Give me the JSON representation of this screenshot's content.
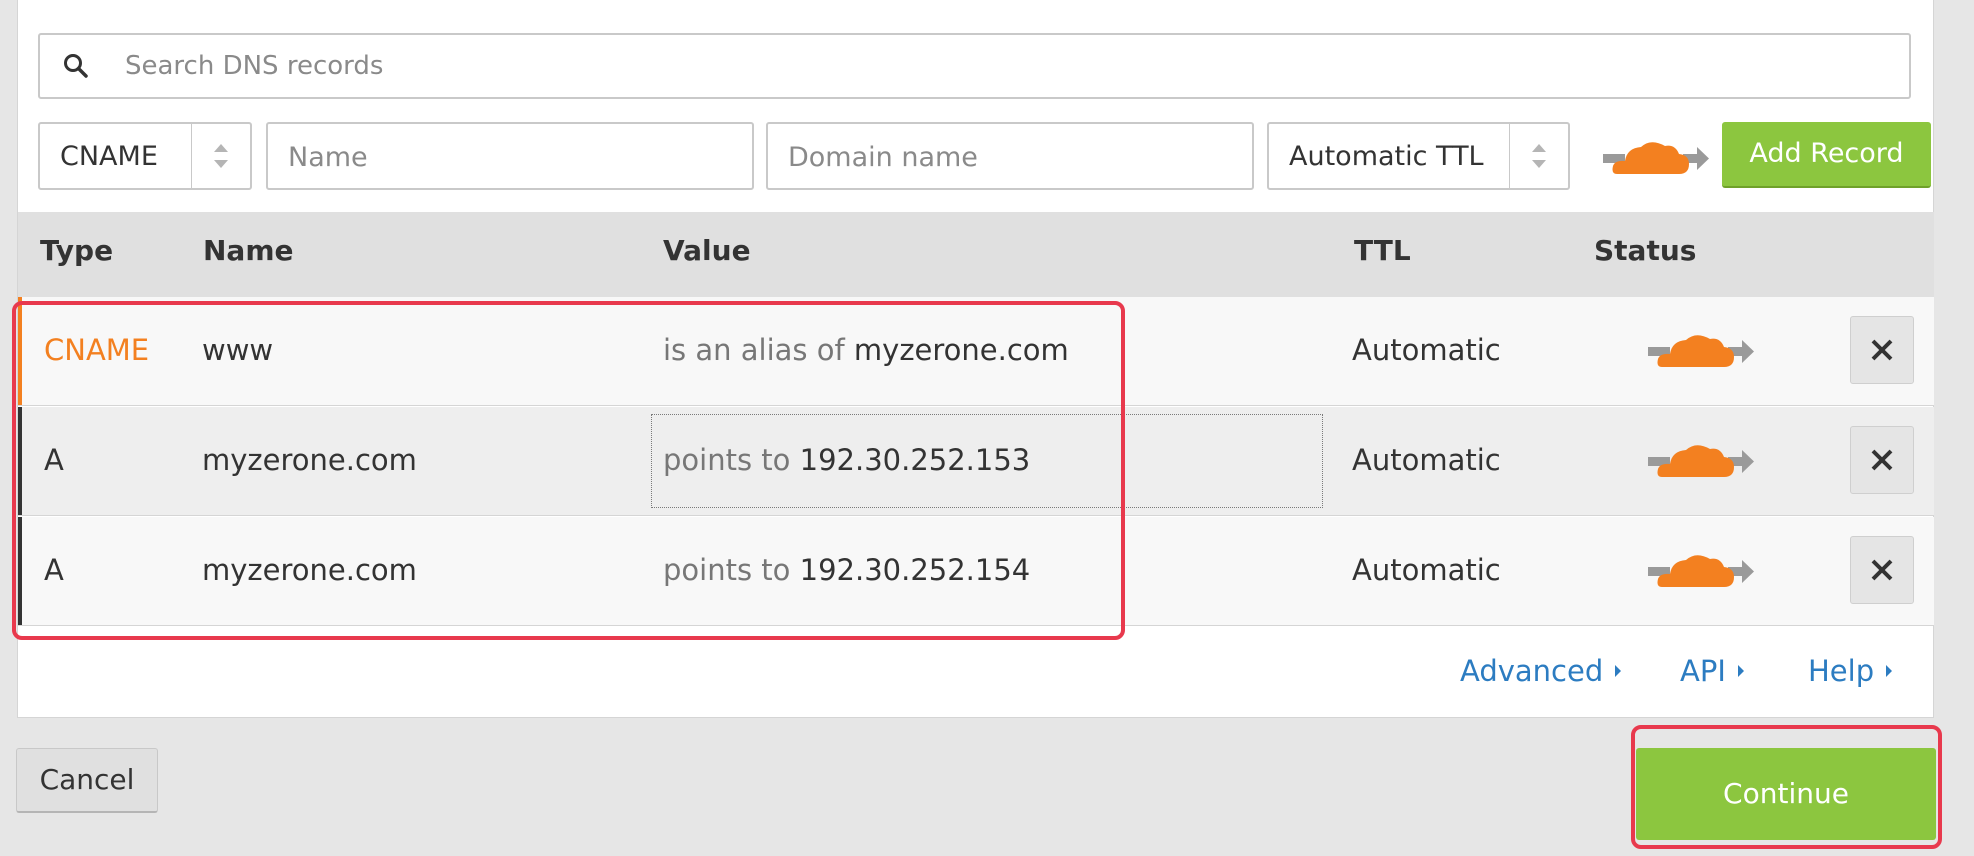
{
  "search": {
    "placeholder": "Search DNS records",
    "icon": "search-icon"
  },
  "add_form": {
    "type_value": "CNAME",
    "name_placeholder": "Name",
    "domain_placeholder": "Domain name",
    "ttl_value": "Automatic TTL",
    "add_label": "Add Record"
  },
  "table": {
    "headers": {
      "type": "Type",
      "name": "Name",
      "value": "Value",
      "ttl": "TTL",
      "status": "Status"
    },
    "rows": [
      {
        "type": "CNAME",
        "name": "www",
        "value_prefix": "is an alias of",
        "value": "myzerone.com",
        "ttl": "Automatic"
      },
      {
        "type": "A",
        "name": "myzerone.com",
        "value_prefix": "points to",
        "value": "192.30.252.153",
        "ttl": "Automatic"
      },
      {
        "type": "A",
        "name": "myzerone.com",
        "value_prefix": "points to",
        "value": "192.30.252.154",
        "ttl": "Automatic"
      }
    ]
  },
  "links": {
    "advanced": "Advanced",
    "api": "API",
    "help": "Help"
  },
  "footer": {
    "cancel": "Cancel",
    "continue": "Continue"
  },
  "colors": {
    "accent_green": "#8cc63f",
    "cname_orange": "#f38020",
    "link_blue": "#2c7cc1",
    "highlight_red": "#e8394d"
  }
}
